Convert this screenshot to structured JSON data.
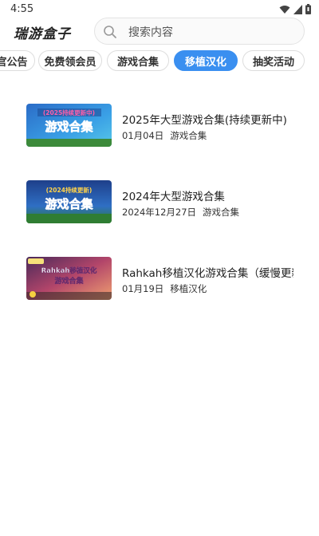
{
  "status_bar": {
    "time": "4:55",
    "icons": [
      "wifi-icon",
      "signal-icon",
      "battery-icon"
    ]
  },
  "header": {
    "app_title": "瑞游盒子",
    "search": {
      "placeholder": "搜索内容",
      "icon": "search-icon"
    }
  },
  "tabs": [
    {
      "label": "官公告",
      "active": false
    },
    {
      "label": "免费领会员",
      "active": false
    },
    {
      "label": "游戏合集",
      "active": false
    },
    {
      "label": "移植汉化",
      "active": true
    },
    {
      "label": "抽奖活动",
      "active": false
    }
  ],
  "colors": {
    "accent": "#3a8ff0"
  },
  "items": [
    {
      "title": "2025年大型游戏合集(持续更新中)",
      "date": "01月04日",
      "category": "游戏合集",
      "thumb_caption": "(2025持续更新中)",
      "thumb_title": "游戏合集"
    },
    {
      "title": "2024年大型游戏合集",
      "date": "2024年12月27日",
      "category": "游戏合集",
      "thumb_caption": "(2024持续更新)",
      "thumb_title": "游戏合集"
    },
    {
      "title": "Rahkah移植汉化游戏合集（缓慢更新",
      "date": "01月19日",
      "category": "移植汉化",
      "thumb_caption": "Rahkah移植汉化",
      "thumb_title": "游戏合集"
    }
  ]
}
